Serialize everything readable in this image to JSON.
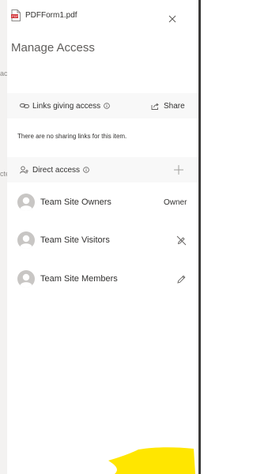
{
  "background_fragment": {
    "top": "acte",
    "mid": "cte"
  },
  "file": {
    "name": "PDFForm1.pdf",
    "icon": "pdf-file-icon"
  },
  "title": "Manage Access",
  "links_section": {
    "label": "Links giving access",
    "share_label": "Share",
    "empty_text": "There are no sharing links for this item."
  },
  "direct_section": {
    "label": "Direct access"
  },
  "members": [
    {
      "name": "Team Site Owners",
      "role": "Owner",
      "action_icon": "none"
    },
    {
      "name": "Team Site Visitors",
      "role": "",
      "action_icon": "no-edit-icon"
    },
    {
      "name": "Team Site Members",
      "role": "",
      "action_icon": "edit-icon"
    }
  ],
  "colors": {
    "highlight": "#ffe600",
    "panel_border": "#3b3a39",
    "pdf_red": "#d13438"
  }
}
